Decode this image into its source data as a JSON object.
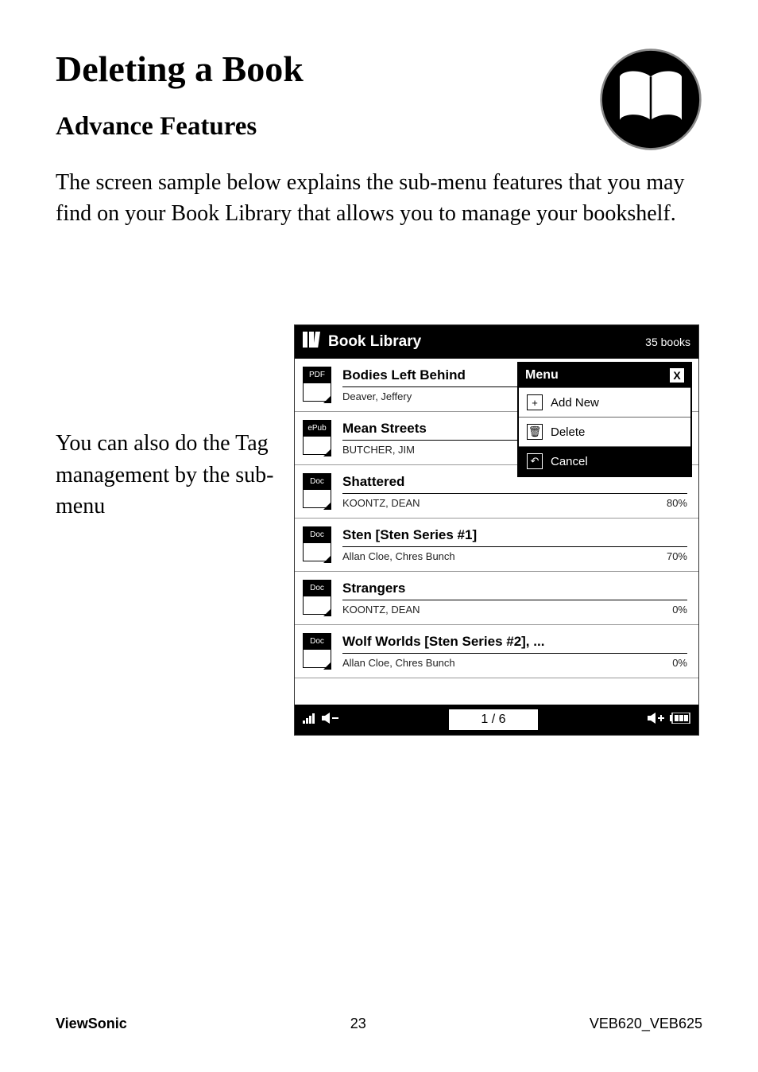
{
  "page": {
    "title": "Deleting a Book",
    "subtitle": "Advance Features",
    "body": "The screen sample below explains the sub-menu features that you may find on your Book Library that allows you to manage your bookshelf.",
    "side_note": "You can also do the Tag management by the sub-menu"
  },
  "device": {
    "header_title": "Book Library",
    "header_count": "35 books",
    "page_indicator": "1 / 6",
    "books": [
      {
        "badge": "PDF",
        "title": "Bodies Left Behind",
        "author": "Deaver, Jeffery",
        "progress": ""
      },
      {
        "badge": "ePub",
        "title": "Mean Streets",
        "author": "BUTCHER, JIM",
        "progress": ""
      },
      {
        "badge": "Doc",
        "title": "Shattered",
        "author": "KOONTZ, DEAN",
        "progress": "80%"
      },
      {
        "badge": "Doc",
        "title": "Sten [Sten Series #1]",
        "author": "Allan Cloe, Chres Bunch",
        "progress": "70%"
      },
      {
        "badge": "Doc",
        "title": "Strangers",
        "author": "KOONTZ, DEAN",
        "progress": "0%"
      },
      {
        "badge": "Doc",
        "title": "Wolf Worlds [Sten Series #2], ...",
        "author": "Allan Cloe, Chres Bunch",
        "progress": "0%"
      }
    ],
    "menu": {
      "title": "Menu",
      "close": "X",
      "items": [
        {
          "icon": "+",
          "label": "Add New",
          "dark": false
        },
        {
          "icon": "🗑",
          "label": "Delete",
          "dark": false
        },
        {
          "icon": "↶",
          "label": "Cancel",
          "dark": true
        }
      ]
    }
  },
  "footer": {
    "brand": "ViewSonic",
    "page_num": "23",
    "model": "VEB620_VEB625"
  }
}
